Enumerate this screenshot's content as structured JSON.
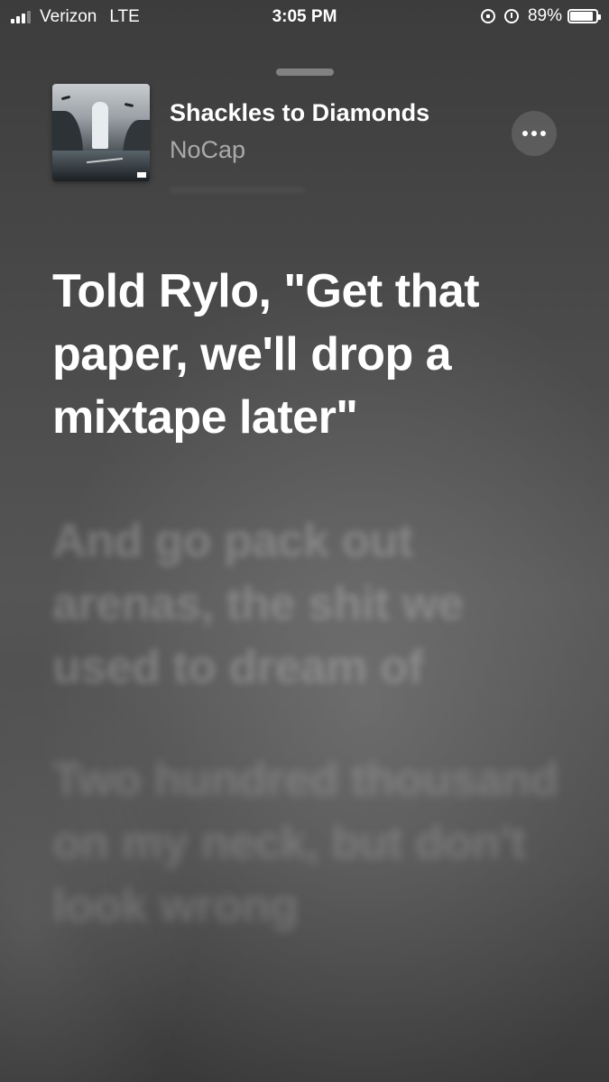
{
  "status_bar": {
    "carrier": "Verizon",
    "network": "LTE",
    "time": "3:05 PM",
    "battery_percent": "89%",
    "battery_level": 0.89,
    "signal_bars_filled": 3,
    "signal_bars_total": 4
  },
  "now_playing": {
    "title": "Shackles to Diamonds",
    "artist": "NoCap",
    "album_art": "album-cover-art",
    "more_icon": "ellipsis-icon"
  },
  "lyrics": {
    "current": "Told Rylo, \"Get that paper, we'll drop a mixtape later\"",
    "next_1": "And go pack out arenas, the shit we used to dream of",
    "next_2": "Two hundred thousand on my neck, but don't look wrong"
  },
  "colors": {
    "background": "#4a4a4a",
    "text": "#ffffff"
  }
}
